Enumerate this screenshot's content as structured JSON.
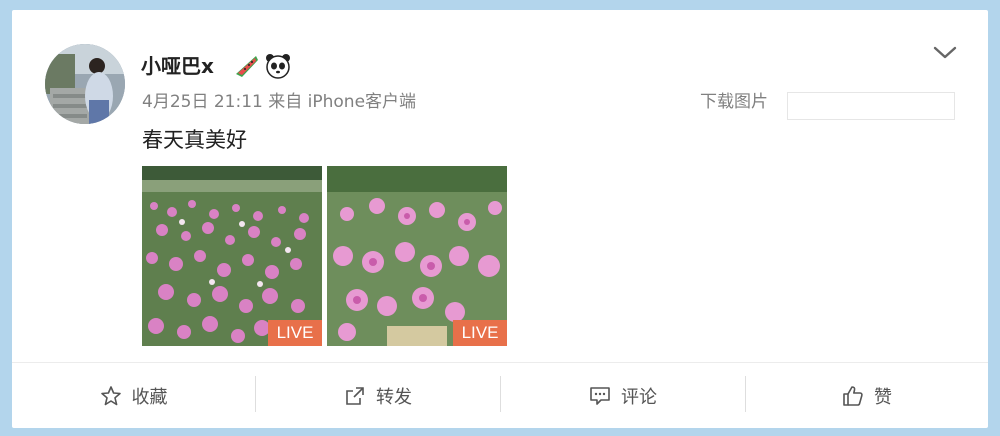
{
  "post": {
    "username": "小哑巴x",
    "username_emojis": [
      "watermelon-emoji",
      "panda-emoji"
    ],
    "meta": "4月25日 21:11 来自 iPhone客户端",
    "download_label": "下载图片",
    "text": "春天真美好",
    "photos": [
      {
        "badge": "LIVE"
      },
      {
        "badge": "LIVE"
      }
    ]
  },
  "actions": {
    "favorite": "收藏",
    "repost": "转发",
    "comment": "评论",
    "like": "赞"
  },
  "colors": {
    "background": "#b3d5ec",
    "live_badge": "#e8704a",
    "text_muted": "#808080"
  }
}
